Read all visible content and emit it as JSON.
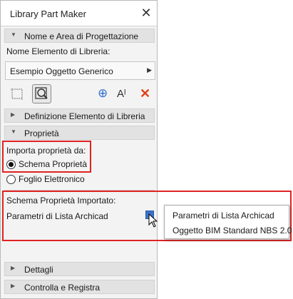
{
  "window": {
    "title": "Library Part Maker",
    "close_glyph": "✕"
  },
  "sections": {
    "nome": "Nome e Area di Progettazione",
    "definizione": "Definizione Elemento di Libreria",
    "proprieta": "Proprietà",
    "dettagli": "Dettagli",
    "controlla": "Controlla e Registra"
  },
  "nome_elemento": {
    "label": "Nome Elemento di Libreria:",
    "value": "Esempio Oggetto Generico"
  },
  "toolbar": {
    "icons": [
      "crop-icon",
      "zoom-fit-icon",
      "add-icon",
      "text-style-icon",
      "delete-icon"
    ],
    "add_glyph": "⊕",
    "text_glyph": "Aᴵ",
    "delete_glyph": "✕"
  },
  "importa": {
    "label": "Importa proprietà da:",
    "options": [
      {
        "label": "Schema Proprietà",
        "checked": true
      },
      {
        "label": "Foglio Elettronico",
        "checked": false
      }
    ]
  },
  "schema_importato": {
    "label": "Schema Proprietà Importato:",
    "value": "Parametri di Lista Archicad"
  },
  "popup_menu": {
    "items": [
      "Parametri di Lista Archicad",
      "Oggetto BIM Standard NBS 2.0"
    ]
  },
  "colors": {
    "highlight_box": "#e02323",
    "delete": "#e0401a",
    "accent": "#3c73c9"
  }
}
